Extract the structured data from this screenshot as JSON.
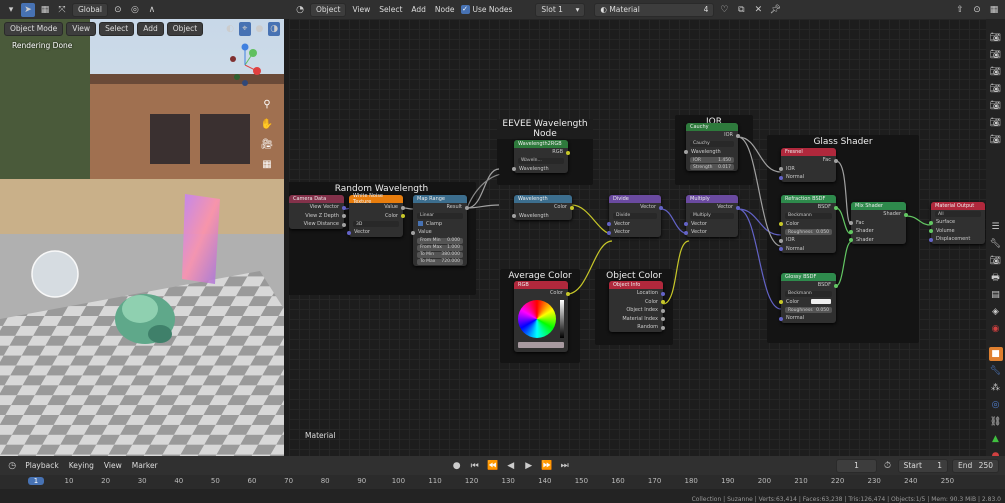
{
  "viewport_header": {
    "mode": "Object Mode",
    "menus": [
      "View",
      "Select",
      "Add",
      "Object"
    ],
    "transform": "Global"
  },
  "viewport": {
    "status": "Rendering Done"
  },
  "node_header": {
    "editor": "Object",
    "menus": [
      "View",
      "Select",
      "Add",
      "Node"
    ],
    "use_nodes": "Use Nodes",
    "slot": "Slot 1",
    "material": "Material",
    "users": "4"
  },
  "node_editor": {
    "label": "Material"
  },
  "frames": {
    "random": "Random Wavelength",
    "eevee": "EEVEE Wavelength Node",
    "ior": "IOR",
    "glass": "Glass Shader",
    "avg": "Average Color",
    "objcol": "Object Color"
  },
  "nodes": {
    "camera": {
      "title": "Camera Data",
      "outputs": [
        "View Vector",
        "View Z Depth",
        "View Distance"
      ]
    },
    "noise": {
      "title": "White Noise Texture",
      "dim": "3D",
      "outputs": [
        "Value",
        "Color"
      ],
      "input": "Vector"
    },
    "maprange": {
      "title": "Map Range",
      "out": "Result",
      "type": "Linear",
      "clamp": "Clamp",
      "in": "Value",
      "fields": [
        [
          "From Min",
          "0.000"
        ],
        [
          "From Max",
          "1.000"
        ],
        [
          "To Min",
          "380.000"
        ],
        [
          "To Max",
          "720.000"
        ]
      ]
    },
    "wl2rgb": {
      "title": "Wavelength2RGB",
      "out": "RGB",
      "field": "Waveln...",
      "in": "Wavelength"
    },
    "wavelength": {
      "title": "Wavelength",
      "out": "Color",
      "in": "Wavelength"
    },
    "divide": {
      "title": "Divide",
      "out": "Vector",
      "op": "Divide",
      "ins": [
        "Vector",
        "Vector"
      ]
    },
    "cauchy": {
      "title": "Cauchy",
      "out": "IOR",
      "mode": "Cauchy",
      "in": "Wavelength",
      "fields": [
        [
          "IOR",
          "1.450"
        ],
        [
          "Strength",
          "0.017"
        ]
      ]
    },
    "multiply": {
      "title": "Multiply",
      "out": "Vector",
      "op": "Multiply",
      "ins": [
        "Vector",
        "Vector"
      ]
    },
    "fresnel": {
      "title": "Fresnel",
      "out": "Fac",
      "ins": [
        "IOR",
        "Normal"
      ]
    },
    "refraction": {
      "title": "Refraction BSDF",
      "out": "BSDF",
      "dist": "Beckmann",
      "ins": [
        "Color",
        "IOR",
        "Normal"
      ],
      "rough": [
        "Roughness",
        "0.050"
      ]
    },
    "glossy": {
      "title": "Glossy BSDF",
      "out": "BSDF",
      "dist": "Beckmann",
      "ins": [
        "Color",
        "Normal"
      ],
      "rough": [
        "Roughness",
        "0.050"
      ]
    },
    "mix": {
      "title": "Mix Shader",
      "out": "Shader",
      "ins": [
        "Fac",
        "Shader",
        "Shader"
      ]
    },
    "matout": {
      "title": "Material Output",
      "target": "All",
      "ins": [
        "Surface",
        "Volume",
        "Displacement"
      ]
    },
    "rgb": {
      "title": "RGB",
      "out": "Color"
    },
    "objinfo": {
      "title": "Object Info",
      "outs": [
        "Location",
        "Color",
        "Object Index",
        "Material Index",
        "Random"
      ]
    }
  },
  "timeline": {
    "menus": [
      "Playback",
      "Keying",
      "View",
      "Marker"
    ],
    "current": "1",
    "start_label": "Start",
    "start": "1",
    "end_label": "End",
    "end": "250",
    "ticks": [
      "1",
      "10",
      "20",
      "30",
      "40",
      "50",
      "60",
      "70",
      "80",
      "90",
      "100",
      "110",
      "120",
      "130",
      "140",
      "150",
      "160",
      "170",
      "180",
      "190",
      "200",
      "210",
      "220",
      "230",
      "240",
      "250"
    ]
  },
  "status": "Collection | Suzanne | Verts:63,414 | Faces:63,238 | Tris:126,474 | Objects:1/5 | Mem: 90.3 MiB | 2.83.0"
}
